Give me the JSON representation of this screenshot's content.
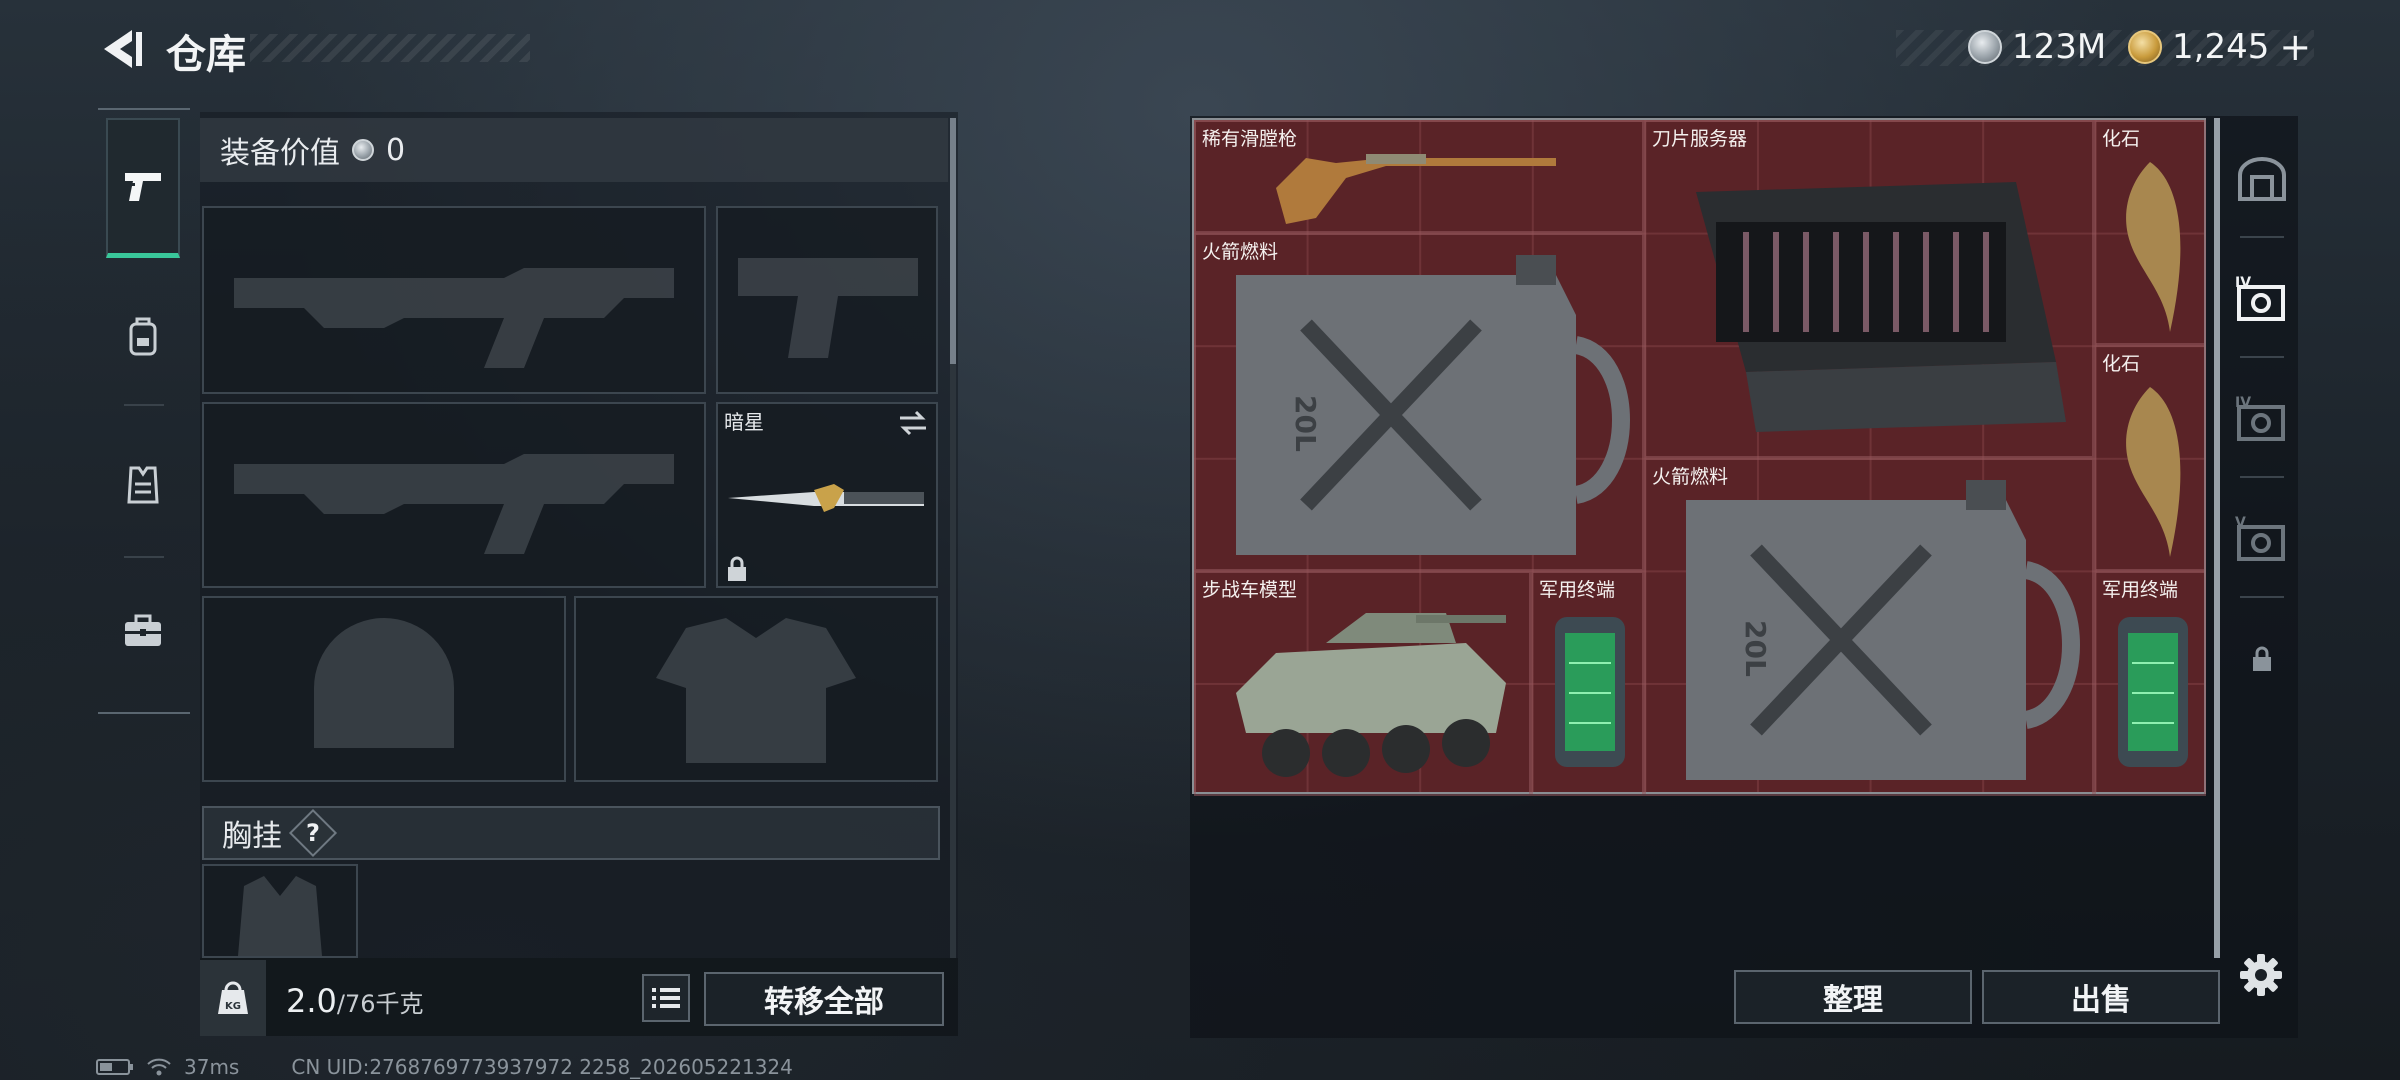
{
  "header": {
    "title": "仓库",
    "currencies": [
      {
        "icon": "silver-coin-icon",
        "amount": "123M"
      },
      {
        "icon": "gold-coin-icon",
        "amount": "1,245"
      }
    ],
    "add_symbol": "+"
  },
  "left_nav": {
    "items": [
      {
        "icon": "pistol-icon",
        "active": true
      },
      {
        "icon": "backpack-icon",
        "active": false
      },
      {
        "icon": "vest-icon",
        "active": false
      },
      {
        "icon": "briefcase-icon",
        "active": false
      }
    ]
  },
  "loadout": {
    "value_label": "装备价值",
    "value": "0",
    "melee_slot_name": "暗星",
    "chest_rig_label": "胸挂",
    "help_symbol": "?",
    "weight_current": "2.0",
    "weight_max": "/76千克",
    "transfer_all_label": "转移全部"
  },
  "storage": {
    "items": [
      {
        "name": "稀有滑膛枪"
      },
      {
        "name": "刀片服务器"
      },
      {
        "name": "化石"
      },
      {
        "name": "火箭燃料"
      },
      {
        "name": "化石"
      },
      {
        "name": "火箭燃料"
      },
      {
        "name": "步战车模型"
      },
      {
        "name": "军用终端"
      },
      {
        "name": "军用终端"
      }
    ],
    "jerrycan_text": "20L",
    "sort_label": "整理",
    "sell_label": "出售"
  },
  "right_tabs": [
    {
      "icon": "safe-box-icon"
    },
    {
      "icon": "storage-tier-iv-icon",
      "badge": "IV",
      "active": true
    },
    {
      "icon": "storage-tier-iv-alt-icon",
      "badge": "IV"
    },
    {
      "icon": "storage-tier-v-icon",
      "badge": "V"
    },
    {
      "icon": "lock-icon"
    }
  ],
  "footer": {
    "ping": "37ms",
    "uid": "CN UID:2768769773937972 2258_202605221324"
  }
}
